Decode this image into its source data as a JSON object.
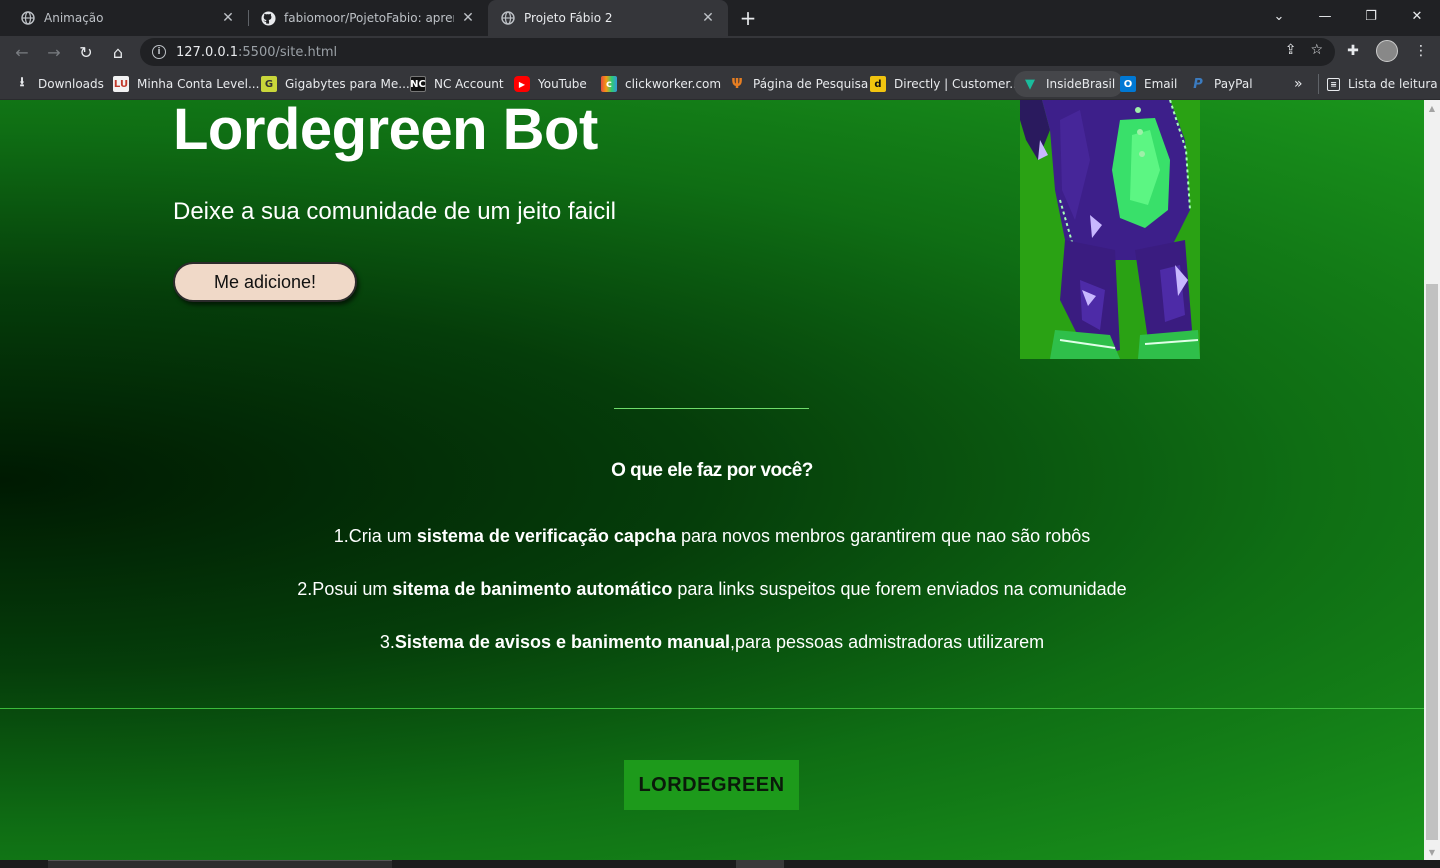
{
  "tabs": [
    {
      "title": "Animação",
      "icon": "globe-icon"
    },
    {
      "title": "fabiomoor/PojetoFabio: aprende",
      "icon": "github-icon"
    },
    {
      "title": "Projeto Fábio 2",
      "icon": "globe-icon",
      "active": true
    }
  ],
  "address": {
    "host": "127.0.0.1",
    "path": ":5500/site.html"
  },
  "bookmarks": [
    {
      "label": "Downloads",
      "icon": "download-icon"
    },
    {
      "label": "Minha Conta Level...",
      "icon": "levelup-icon"
    },
    {
      "label": "Gigabytes para Me...",
      "icon": "gigabytes-icon"
    },
    {
      "label": "NC Account",
      "icon": "nc-icon"
    },
    {
      "label": "YouTube",
      "icon": "youtube-icon"
    },
    {
      "label": "clickworker.com",
      "icon": "clickworker-icon"
    },
    {
      "label": "Página de Pesquisa",
      "icon": "survey-icon"
    },
    {
      "label": "Directly | Customer...",
      "icon": "directly-icon"
    },
    {
      "label": "InsideBrasil",
      "icon": "insidebrasil-icon"
    },
    {
      "label": "Email",
      "icon": "outlook-icon"
    },
    {
      "label": "PayPal",
      "icon": "paypal-icon"
    }
  ],
  "overflow_label": "»",
  "reading_list_label": "Lista de leitura",
  "page": {
    "hero_title": "Lordegreen Bot",
    "hero_subtitle": "Deixe a sua comunidade de um jeito faicil",
    "cta_label": "Me adicione!",
    "section_title": "O que ele faz por você?",
    "features": [
      {
        "prefix": "1.Cria um ",
        "bold": "sistema de verificação capcha",
        "suffix": " para novos menbros garantirem que nao são robôs"
      },
      {
        "prefix": "2.Posui um ",
        "bold": "sitema de banimento automático",
        "suffix": " para links suspeitos que forem enviados na comunidade"
      },
      {
        "prefix": "3.",
        "bold": "Sistema de avisos e banimento manual",
        "suffix": ",para pessoas admistradoras utilizarem"
      }
    ],
    "footer_logo": "LORDEGREEN"
  },
  "colors": {
    "brand_green": "#1d9a1b",
    "cta_bg": "#f0d9c8",
    "divider": "#6fdc6b"
  }
}
